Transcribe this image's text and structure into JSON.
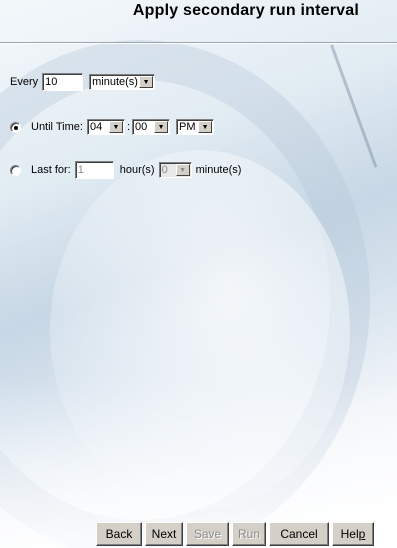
{
  "header": {
    "title": "Apply secondary run interval"
  },
  "every": {
    "label": "Every",
    "value": "10",
    "unit_selected": "minute(s)"
  },
  "until_time": {
    "label": "Until Time:",
    "selected": true,
    "hour": "04",
    "separator": ":",
    "minute": "00",
    "ampm": "PM"
  },
  "last_for": {
    "label": "Last for:",
    "selected": false,
    "hours_value": "1",
    "hours_label": "hour(s)",
    "minutes_value": "0",
    "minutes_label": "minute(s)"
  },
  "buttons": {
    "back": "Back",
    "next": "Next",
    "save": "Save",
    "run": "Run",
    "cancel": "Cancel",
    "help_prefix": "Hel",
    "help_mnemonic": "p"
  },
  "icons": {
    "dropdown": "chevron-down-icon",
    "radio": "radio-icon"
  },
  "colors": {
    "selection_highlight": "#0a246a",
    "button_face": "#d4d0c8",
    "disabled_text": "#8c8c8c"
  }
}
